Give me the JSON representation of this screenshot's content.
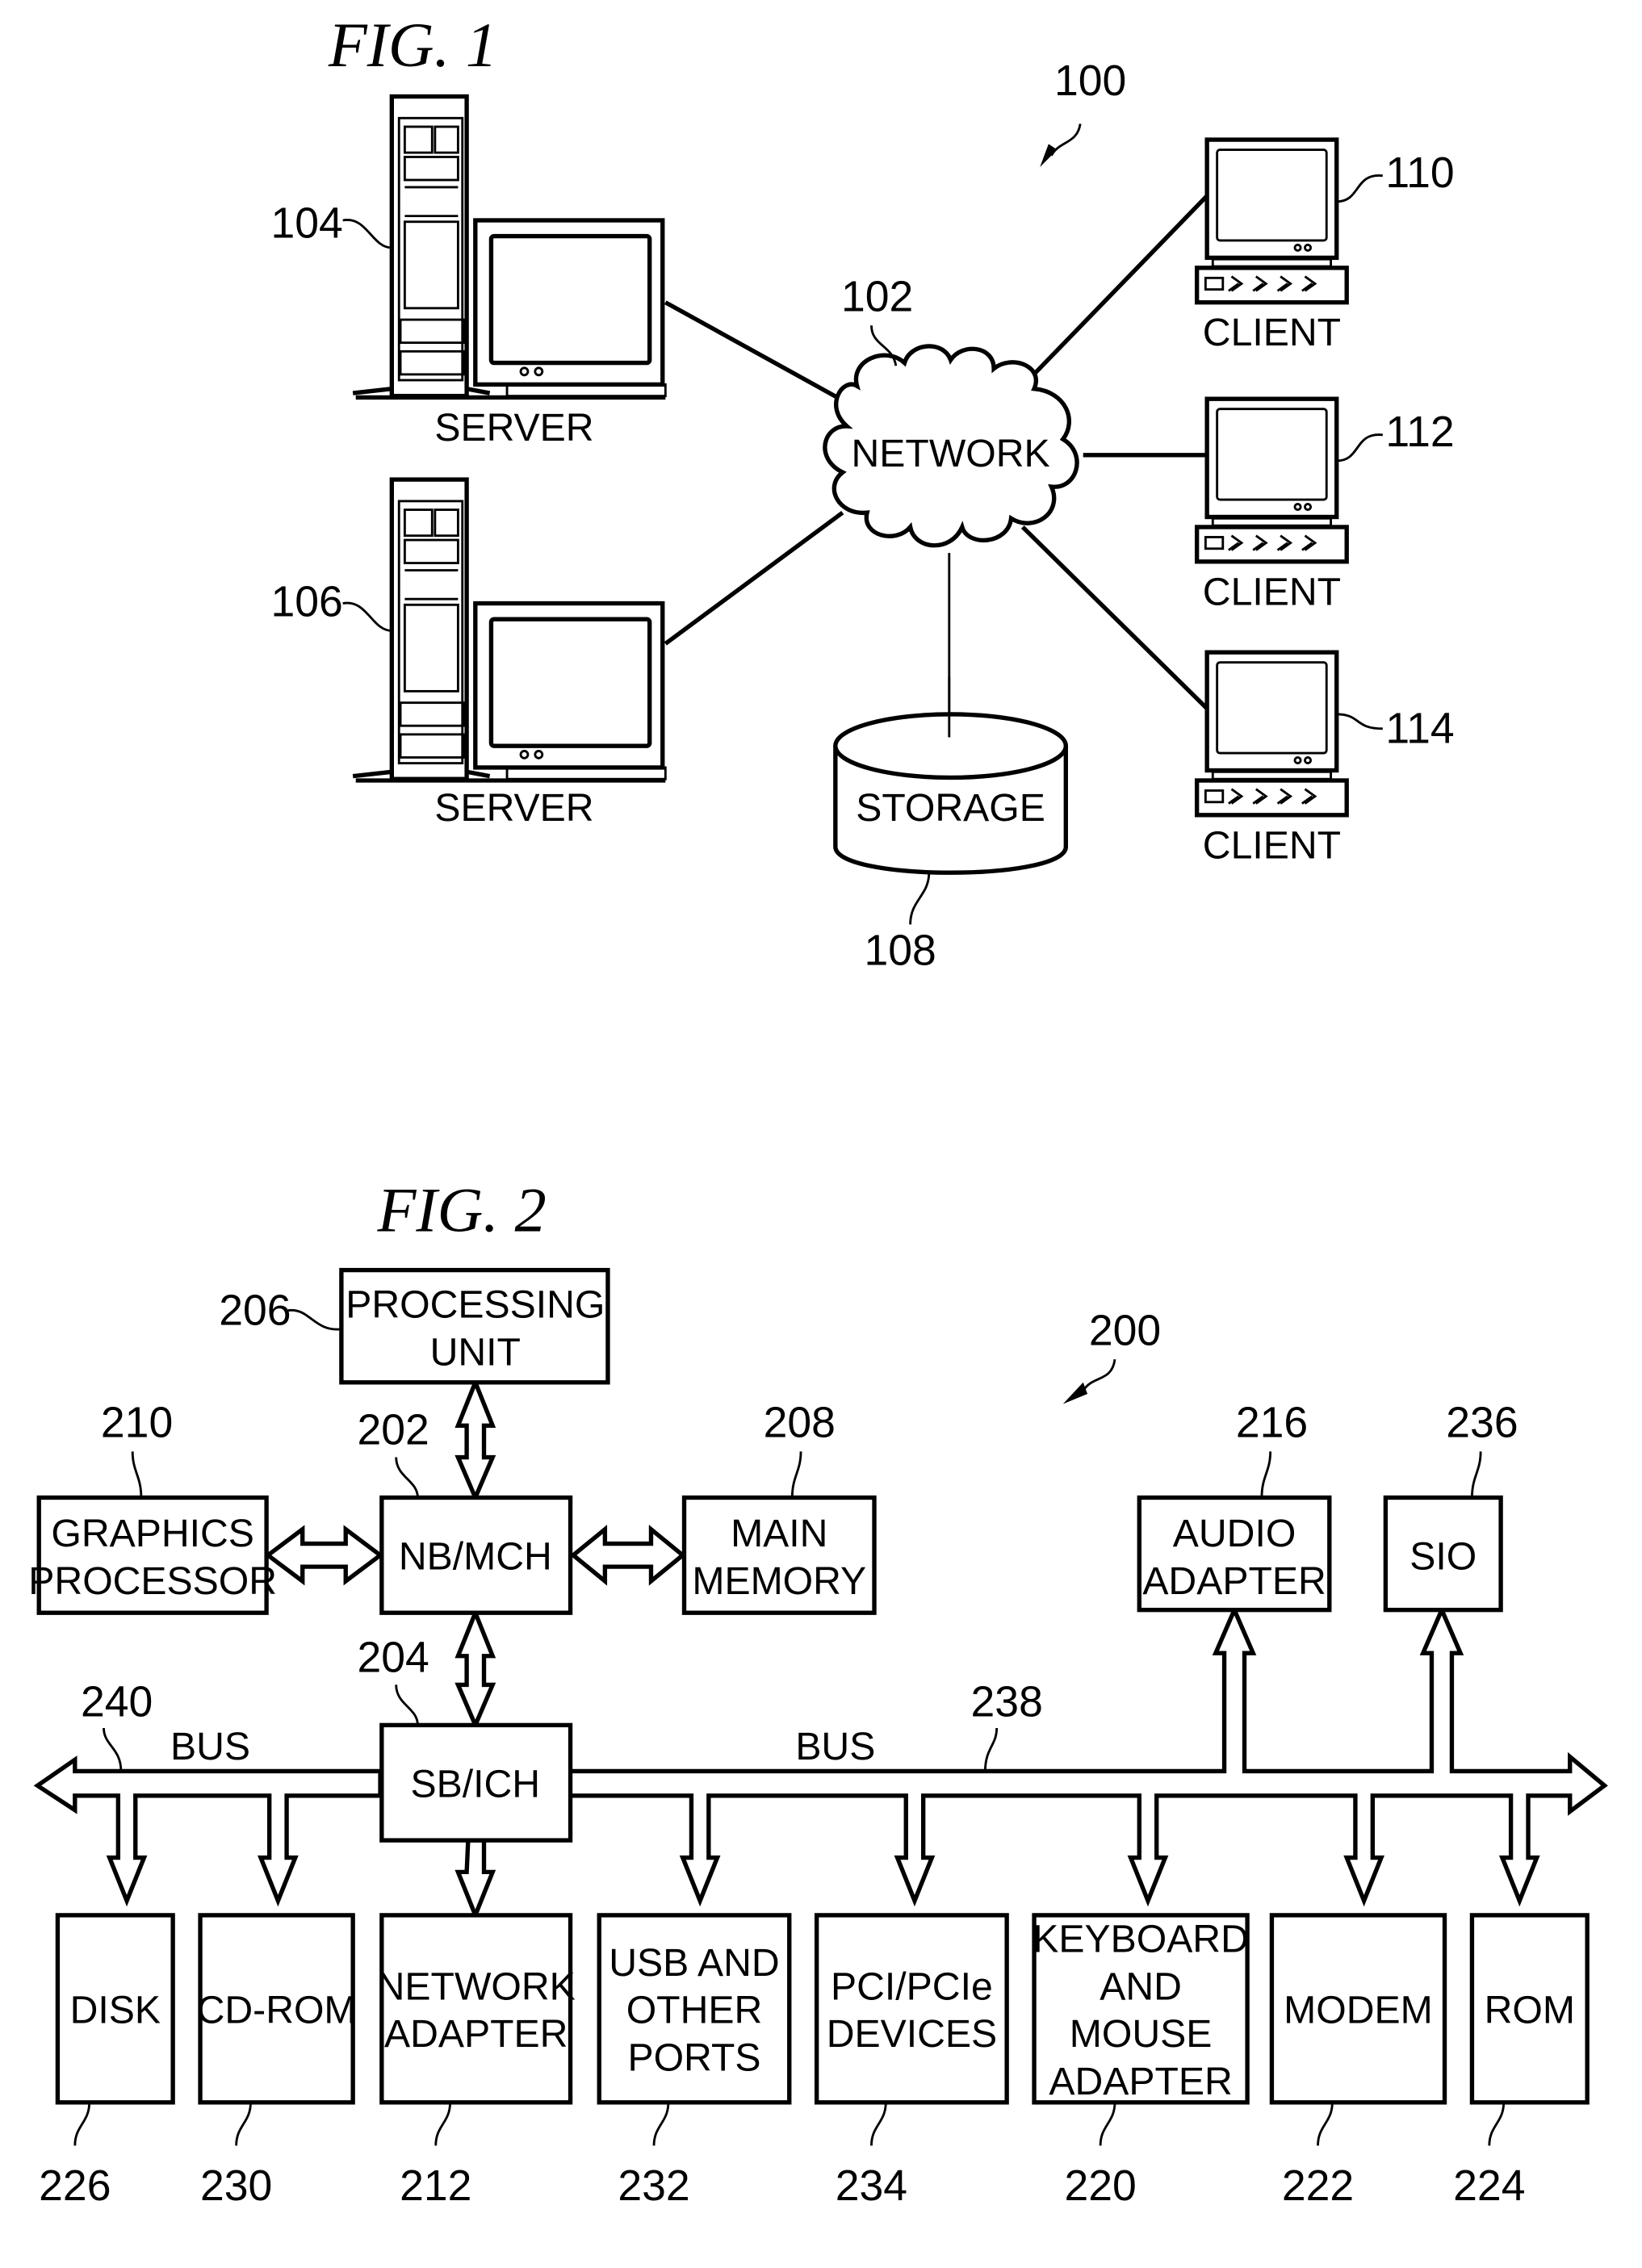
{
  "fig1": {
    "title": "FIG. 1",
    "system_ref": "100",
    "network": {
      "label": "NETWORK",
      "ref": "102"
    },
    "servers": [
      {
        "label": "SERVER",
        "ref": "104"
      },
      {
        "label": "SERVER",
        "ref": "106"
      }
    ],
    "storage": {
      "label": "STORAGE",
      "ref": "108"
    },
    "clients": [
      {
        "label": "CLIENT",
        "ref": "110"
      },
      {
        "label": "CLIENT",
        "ref": "112"
      },
      {
        "label": "CLIENT",
        "ref": "114"
      }
    ]
  },
  "fig2": {
    "title": "FIG. 2",
    "system_ref": "200",
    "processing_unit": {
      "lines": [
        "PROCESSING",
        "UNIT"
      ],
      "ref": "206"
    },
    "graphics_processor": {
      "lines": [
        "GRAPHICS",
        "PROCESSOR"
      ],
      "ref": "210"
    },
    "nb_mch": {
      "lines": [
        "NB/MCH"
      ],
      "ref": "202"
    },
    "main_memory": {
      "lines": [
        "MAIN",
        "MEMORY"
      ],
      "ref": "208"
    },
    "sb_ich": {
      "lines": [
        "SB/ICH"
      ],
      "ref": "204"
    },
    "audio_adapter": {
      "lines": [
        "AUDIO",
        "ADAPTER"
      ],
      "ref": "216"
    },
    "sio": {
      "lines": [
        "SIO"
      ],
      "ref": "236"
    },
    "bus_left": {
      "label": "BUS",
      "ref": "240"
    },
    "bus_right": {
      "label": "BUS",
      "ref": "238"
    },
    "devices": [
      {
        "lines": [
          "DISK"
        ],
        "ref": "226"
      },
      {
        "lines": [
          "CD-ROM"
        ],
        "ref": "230"
      },
      {
        "lines": [
          "NETWORK",
          "ADAPTER"
        ],
        "ref": "212"
      },
      {
        "lines": [
          "USB AND",
          "OTHER",
          "PORTS"
        ],
        "ref": "232"
      },
      {
        "lines": [
          "PCI/PCIe",
          "DEVICES"
        ],
        "ref": "234"
      },
      {
        "lines": [
          "KEYBOARD",
          "AND",
          "MOUSE",
          "ADAPTER"
        ],
        "ref": "220"
      },
      {
        "lines": [
          "MODEM"
        ],
        "ref": "222"
      },
      {
        "lines": [
          "ROM"
        ],
        "ref": "224"
      }
    ]
  }
}
